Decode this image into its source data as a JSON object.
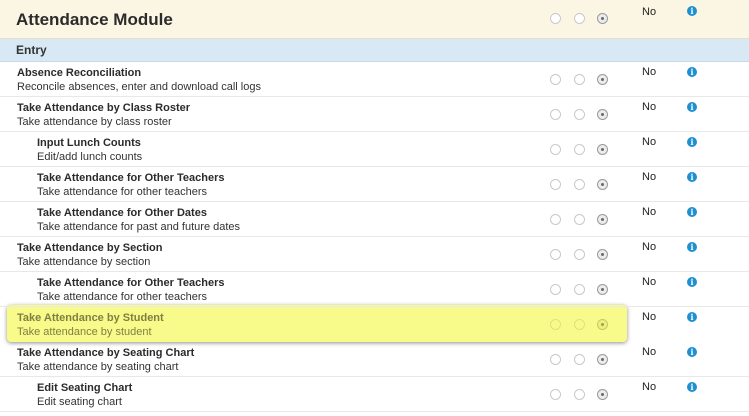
{
  "module": {
    "title": "Attendance Module",
    "access_value": "No",
    "info_icon": "info-icon"
  },
  "section": {
    "title": "Entry"
  },
  "rows": [
    {
      "title": "Absence Reconciliation",
      "description": "Reconcile absences, enter and download call logs",
      "access": "No",
      "indent": 0
    },
    {
      "title": "Take Attendance by Class Roster",
      "description": "Take attendance by class roster",
      "access": "No",
      "indent": 0
    },
    {
      "title": "Input Lunch Counts",
      "description": "Edit/add lunch counts",
      "access": "No",
      "indent": 1
    },
    {
      "title": "Take Attendance for Other Teachers",
      "description": "Take attendance for other teachers",
      "access": "No",
      "indent": 1
    },
    {
      "title": "Take Attendance for Other Dates",
      "description": "Take attendance for past and future dates",
      "access": "No",
      "indent": 1
    },
    {
      "title": "Take Attendance by Section",
      "description": "Take attendance by section",
      "access": "No",
      "indent": 0
    },
    {
      "title": "Take Attendance for Other Teachers",
      "description": "Take attendance for other teachers",
      "access": "No",
      "indent": 1
    },
    {
      "title": "Take Attendance by Student",
      "description": "Take attendance by student",
      "access": "No",
      "indent": 0,
      "highlighted": true
    },
    {
      "title": "Take Attendance by Seating Chart",
      "description": "Take attendance by seating chart",
      "access": "No",
      "indent": 0
    },
    {
      "title": "Edit Seating Chart",
      "description": "Edit seating chart",
      "access": "No",
      "indent": 1
    }
  ],
  "colors": {
    "module_header_bg": "#fbf6e3",
    "section_header_bg": "#d8e8f5",
    "highlight": "#f8fb8a",
    "info_icon": "#1e8fd0"
  }
}
